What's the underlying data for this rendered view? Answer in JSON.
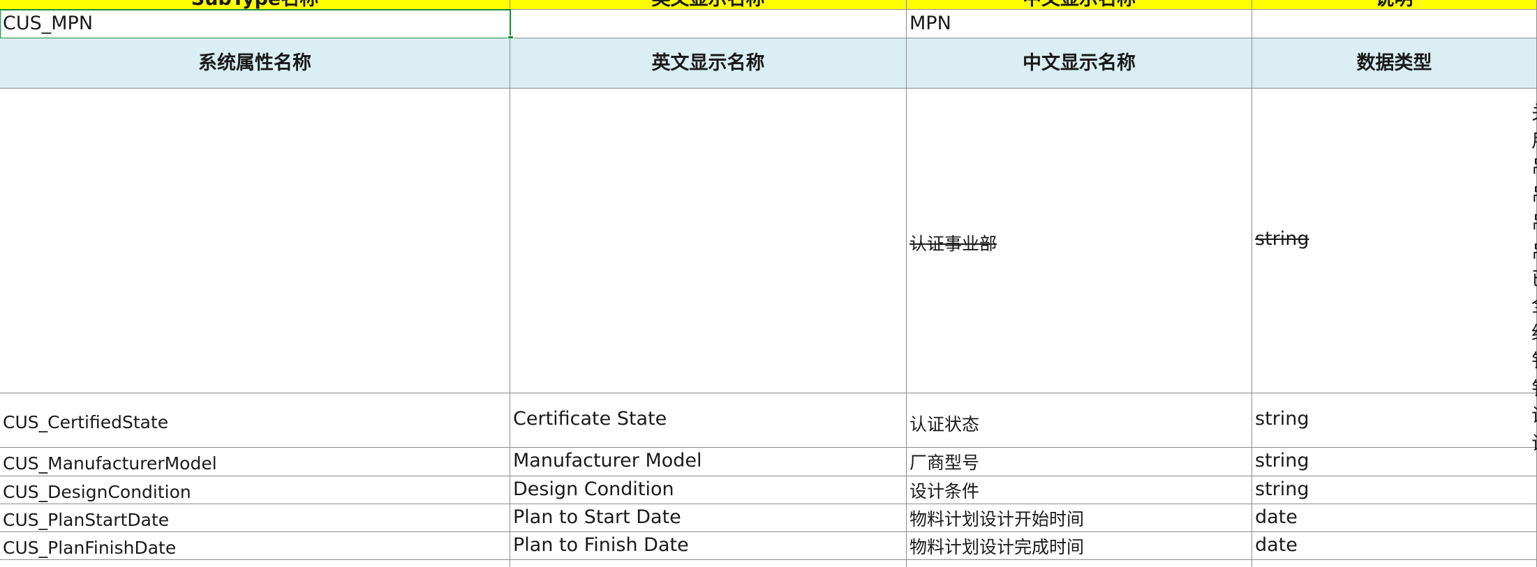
{
  "top_header": {
    "col1": "SubType名称",
    "col2": "英文显示名称",
    "col3": "中文显示名称",
    "col4": "说明"
  },
  "subtype_row": {
    "col1": "CUS_MPN",
    "col2": "",
    "col3": "MPN",
    "col4": ""
  },
  "attr_header": {
    "col1": "系统属性名称",
    "col2": "英文显示名称",
    "col3": "中文显示名称",
    "col4": "数据类型"
  },
  "rows": [
    {
      "sys": "",
      "en": "",
      "cn": "认证事业部",
      "type": "string"
    },
    {
      "sys": "CUS_CertifiedState",
      "en": "Certificate State",
      "cn": "认证状态",
      "type": "string"
    },
    {
      "sys": "CUS_ManufacturerModel",
      "en": "Manufacturer Model",
      "cn": "厂商型号",
      "type": "string"
    },
    {
      "sys": "CUS_DesignCondition",
      "en": "Design Condition",
      "cn": "设计条件",
      "type": "string"
    },
    {
      "sys": "CUS_PlanStartDate",
      "en": "Plan to Start Date",
      "cn": "物料计划设计开始时间",
      "type": "date"
    },
    {
      "sys": "CUS_PlanFinishDate",
      "en": "Plan to Finish Date",
      "cn": "物料计划设计完成时间",
      "type": "date"
    }
  ],
  "edge_glyphs": [
    "关",
    "用",
    "吊",
    "吊",
    "吊",
    "吊",
    "已",
    "全",
    "经",
    "钅",
    "钅",
    "试",
    "试"
  ],
  "colors": {
    "header_yellow": "#ffff00",
    "header_blue": "#daeef3",
    "selection": "#1e8a3e"
  }
}
